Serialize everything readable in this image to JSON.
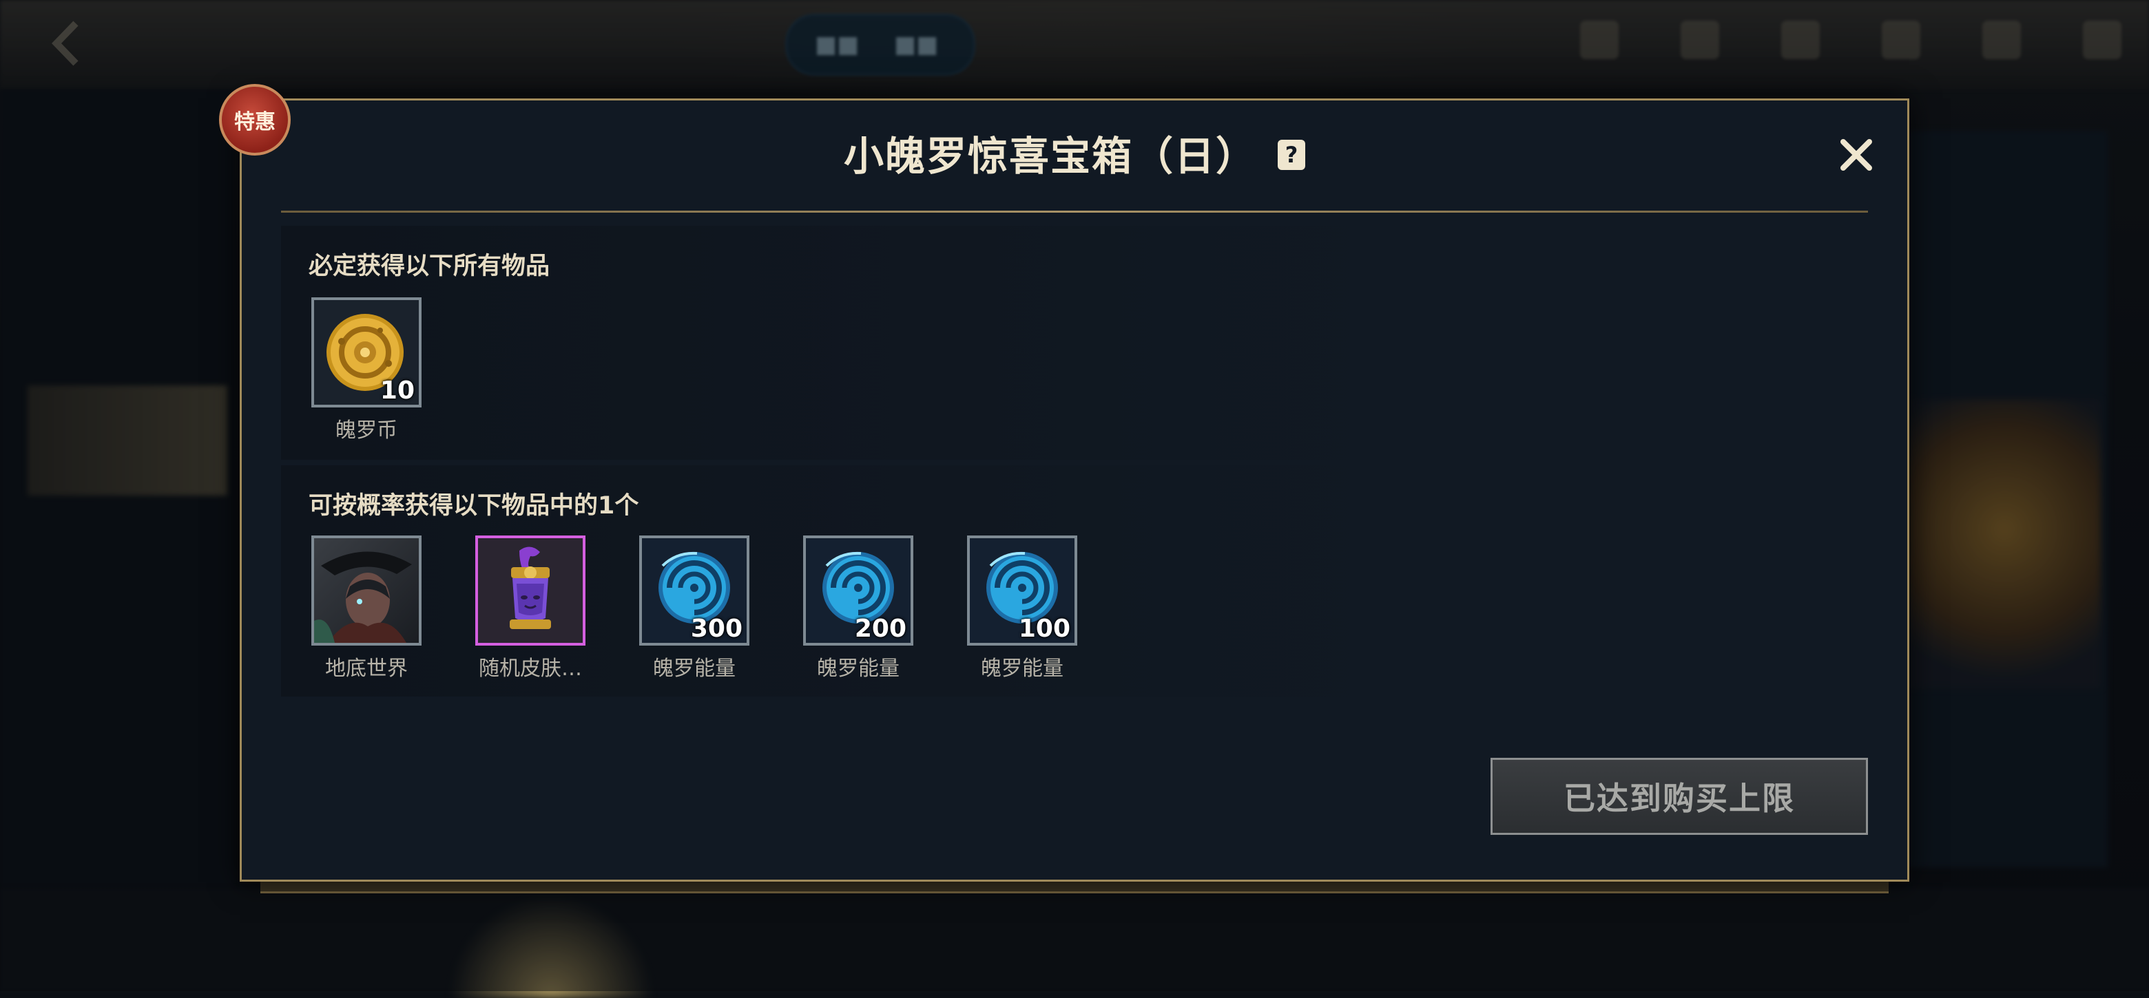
{
  "dialog": {
    "title": "小魄罗惊喜宝箱（日）",
    "promo_badge": "特惠",
    "help_icon": "question-icon",
    "close_icon": "close-icon"
  },
  "guaranteed_section": {
    "heading": "必定获得以下所有物品",
    "items": [
      {
        "name": "魄罗币",
        "count": "10",
        "icon": "poro-coin-icon"
      }
    ]
  },
  "chance_section": {
    "heading": "可按概率获得以下物品中的1个",
    "items": [
      {
        "name": "地底世界",
        "count": "",
        "icon": "skin-portrait-icon"
      },
      {
        "name": "随机皮肤…",
        "count": "",
        "icon": "random-skin-icon"
      },
      {
        "name": "魄罗能量",
        "count": "300",
        "icon": "poro-energy-icon"
      },
      {
        "name": "魄罗能量",
        "count": "200",
        "icon": "poro-energy-icon"
      },
      {
        "name": "魄罗能量",
        "count": "100",
        "icon": "poro-energy-icon"
      }
    ]
  },
  "buy_button": {
    "label": "已达到购买上限",
    "enabled": false
  },
  "colors": {
    "gold_border": "#a08a5a",
    "rare_border": "#d45fe0",
    "badge_red": "#8e2219"
  }
}
